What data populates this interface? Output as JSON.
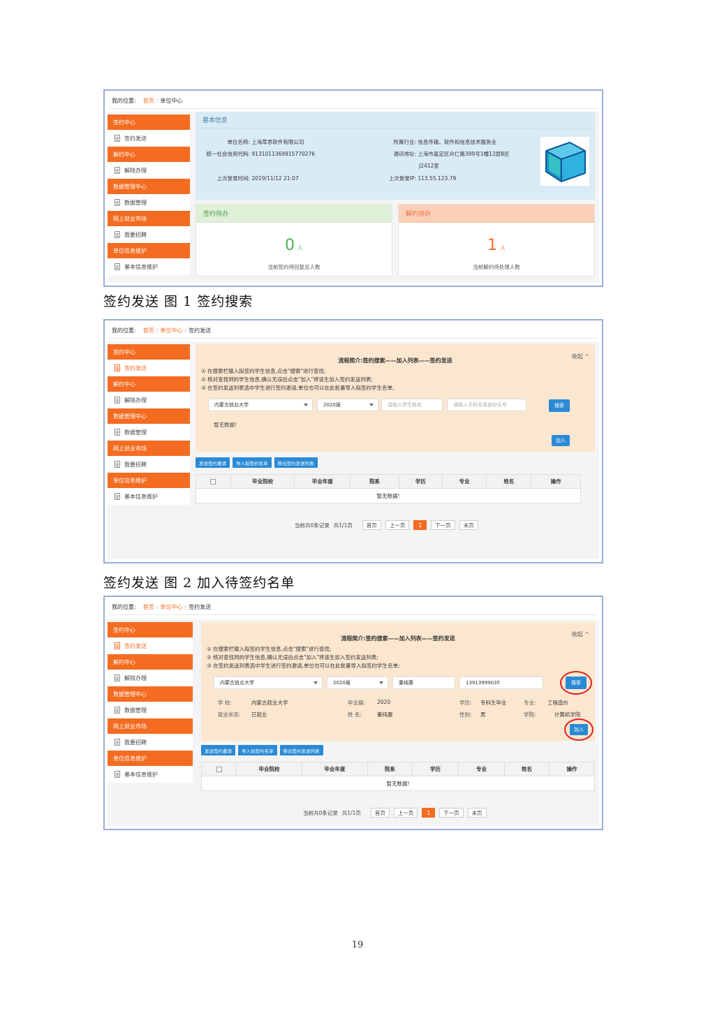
{
  "common": {
    "location_label": "我的位置:",
    "crumb_home": "首页",
    "crumb_center": "单位中心",
    "crumb_send": "签约发送",
    "sidebar": {
      "groups": [
        {
          "title": "签约中心",
          "item": "签约发送"
        },
        {
          "title": "解约中心",
          "item": "解除办理"
        },
        {
          "title": "数据管理中心",
          "item": "数据管理"
        },
        {
          "title": "网上就业市场",
          "item": "我要招聘"
        },
        {
          "title": "单位信息维护",
          "item": "基本信息维护"
        }
      ]
    },
    "flow": {
      "title": "流程简介:签约搜索——加入列表——签约发送",
      "fold": "收起 ^",
      "step1": "① 在搜索栏输入拟签约学生信息,点击\"搜索\"进行查找;",
      "step2": "② 核对查找到的学生信息,确认无误后点击\"加入\"将该生加入签约发送列表;",
      "step3": "③ 在签约发送列表选中学生进行签约邀请,单位也可以在此批量导入拟签约学生名单;",
      "school": "内蒙古就业大学",
      "year": "2020届",
      "name_placeholder": "请输入学生姓名",
      "id_placeholder": "请输入手机号或身份证号",
      "search": "搜索",
      "add": "加入",
      "no_data": "暂无数据!"
    },
    "actions": [
      "发送签约邀请",
      "导入拟签约名单",
      "移出签约发送列表"
    ],
    "table_headers": [
      "毕业院校",
      "毕业年度",
      "院系",
      "学历",
      "专业",
      "姓名",
      "操作"
    ],
    "table_empty": "暂无数据!",
    "pager": {
      "summary": "当前共0条记录",
      "pages": "共1/1页",
      "first": "首页",
      "prev": "上一页",
      "current": "1",
      "next": "下一页",
      "last": "末页"
    }
  },
  "shot1": {
    "basic_title": "基本信息",
    "unit_name_label": "单位名称:",
    "unit_name": "上海萃思软件有限公司",
    "credit_label": "统一社会信用代码:",
    "credit": "9131011369915770276",
    "last_login_label": "上次登录时间:",
    "last_login": "2019/11/12 21:07",
    "industry_label": "所属行业:",
    "industry": "信息传输、软件和信息技术服务业",
    "address_label": "通讯地址:",
    "address1": "上海市嘉定区众仁路399号1幢12层B区",
    "address2": "J2412室",
    "ip_label": "上次登录IP:",
    "ip": "113.55.123.79",
    "pending_sign_title": "签约待办",
    "pending_sign_count": "0",
    "pending_sign_unit": "人",
    "pending_sign_desc": "当前签约待回复总人数",
    "pending_unsign_title": "解约待办",
    "pending_unsign_count": "1",
    "pending_unsign_unit": "人",
    "pending_unsign_desc": "当前解约待处理人数"
  },
  "captions": {
    "c1": "签约发送 图 1 签约搜索",
    "c2": "签约发送 图 2 加入待签约名单"
  },
  "shot3": {
    "name_value": "董纯惠",
    "phone_value": "13913999035",
    "school_label": "学 校:",
    "school_value": "内蒙古就业大学",
    "status_label": "就业状态:",
    "status_value": "已就业",
    "grad_label": "毕业届:",
    "grad_value": "2020",
    "sname_label": "姓 名:",
    "sname_value": "董纯惠",
    "edu_label": "学历:",
    "edu_value": "专科生毕业",
    "gender_label": "性别:",
    "gender_value": "男",
    "major_label": "专业:",
    "major_value": "工程造价",
    "college_label": "学院:",
    "college_value": "计算机学院"
  },
  "page_number": "19"
}
